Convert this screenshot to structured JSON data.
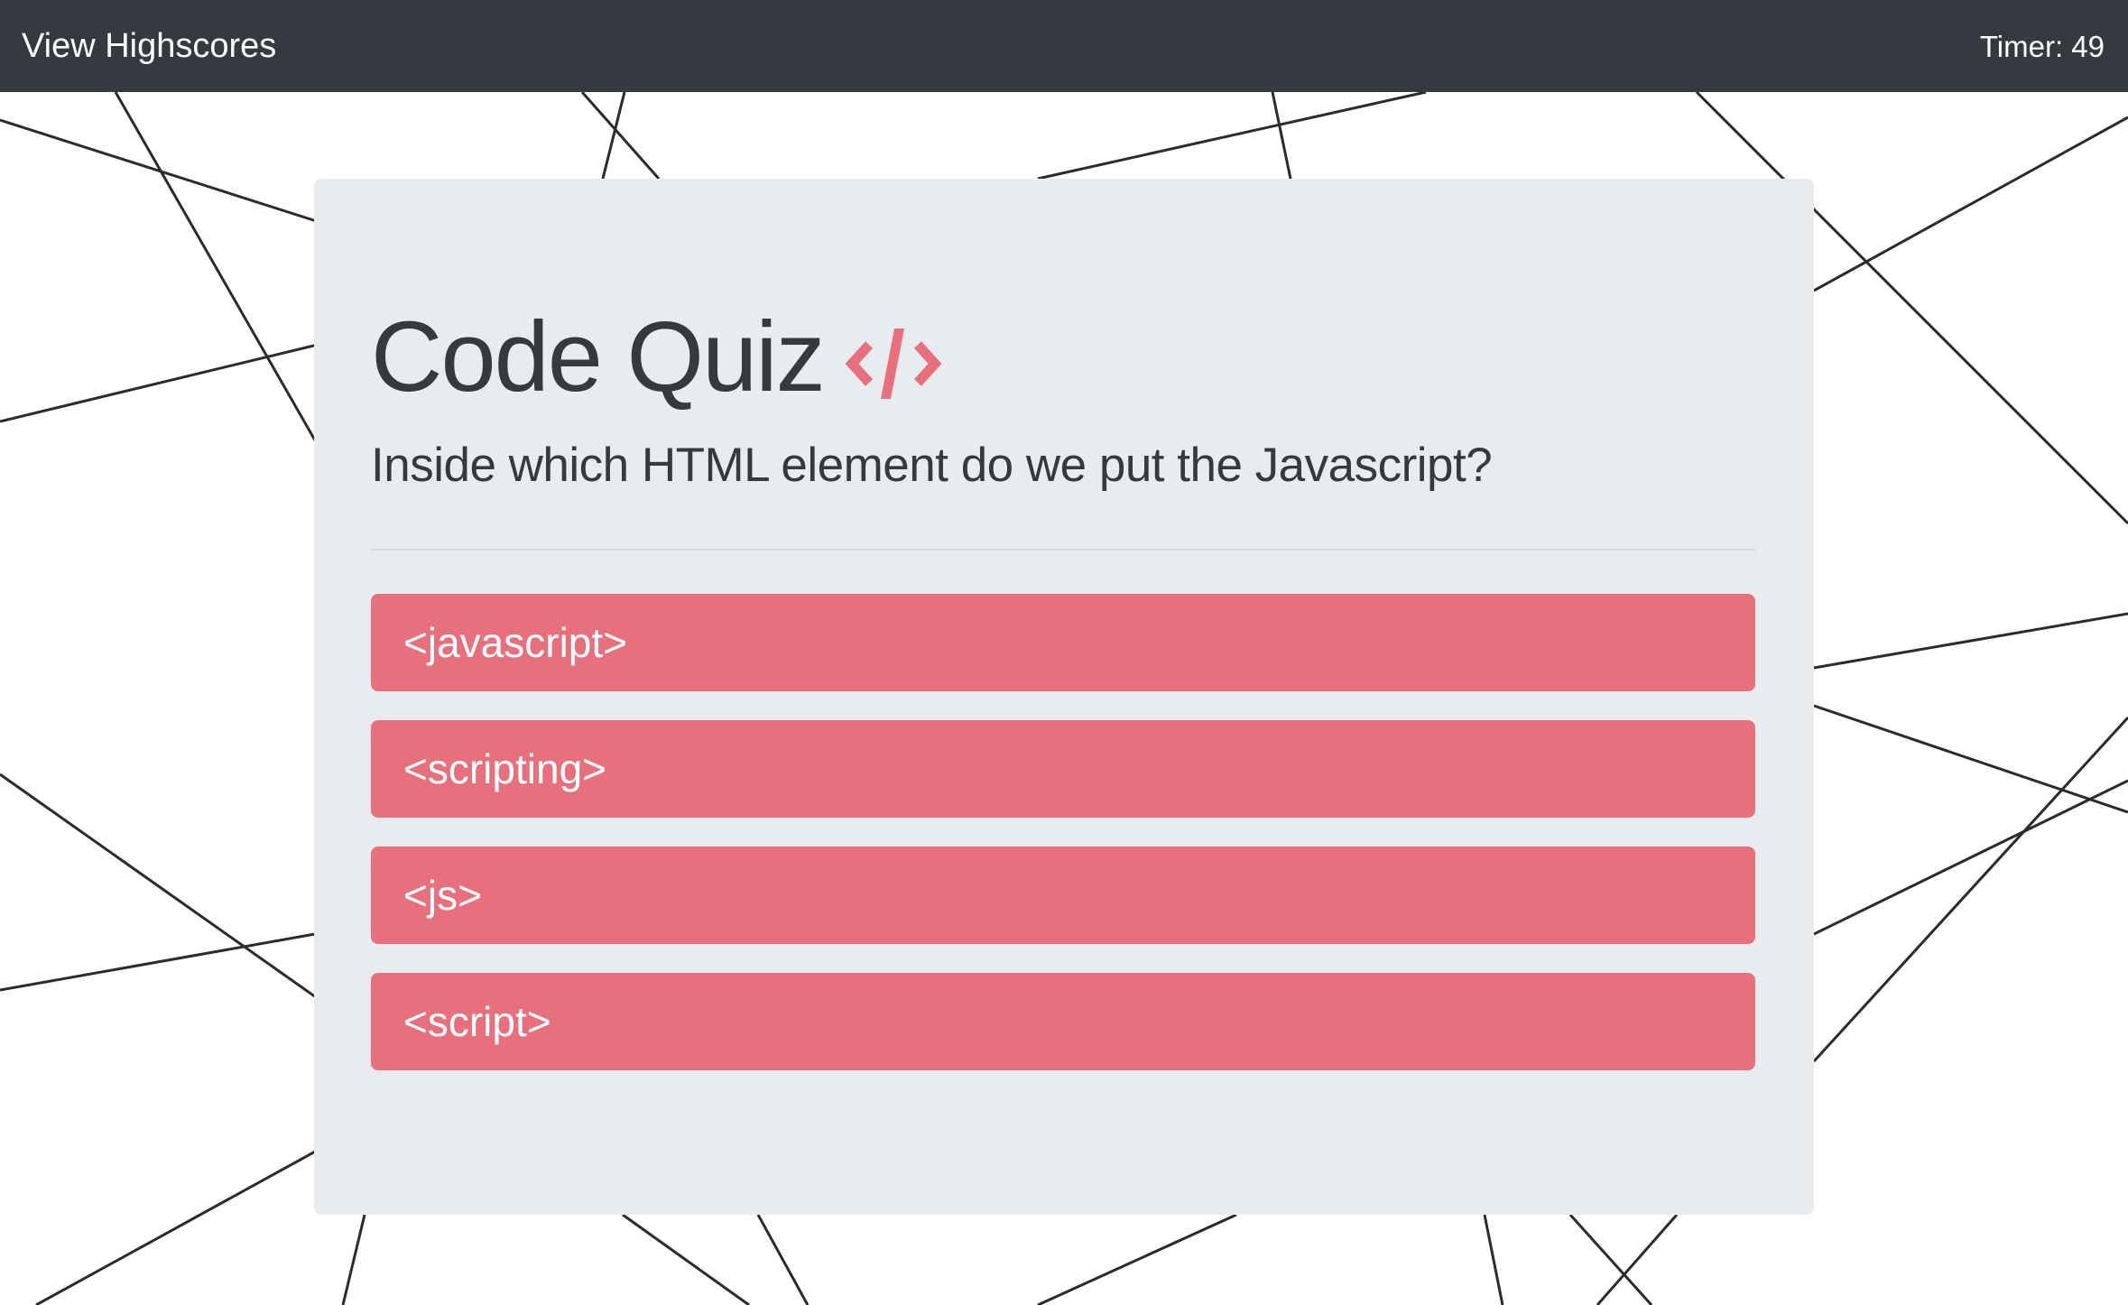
{
  "navbar": {
    "highscores_link": "View Highscores",
    "timer_text": "Timer: 49"
  },
  "quiz": {
    "title": "Code Quiz",
    "title_icon": "code-icon",
    "question": "Inside which HTML element do we put the Javascript?",
    "answers": [
      "<javascript>",
      "<scripting>",
      "<js>",
      "<script>"
    ]
  },
  "colors": {
    "navbar_bg": "#343a40",
    "card_bg": "#e9ecef",
    "answer_bg": "#e8707d",
    "accent": "#e8707d",
    "text_dark": "#343a40"
  }
}
